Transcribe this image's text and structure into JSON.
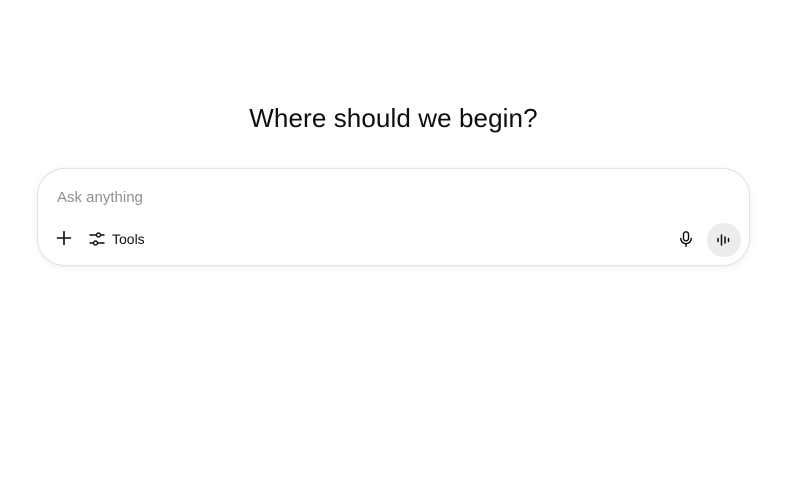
{
  "heading": "Where should we begin?",
  "composer": {
    "placeholder": "Ask anything",
    "value": "",
    "tools_label": "Tools",
    "icons": {
      "add": "plus-icon",
      "tools": "sliders-icon",
      "dictate": "microphone-icon",
      "voice": "voice-waveform-icon"
    }
  },
  "colors": {
    "text": "#0d0d0d",
    "placeholder": "#8f8f8f",
    "border": "#e3e3e3",
    "voice_button_bg": "#ececec"
  }
}
